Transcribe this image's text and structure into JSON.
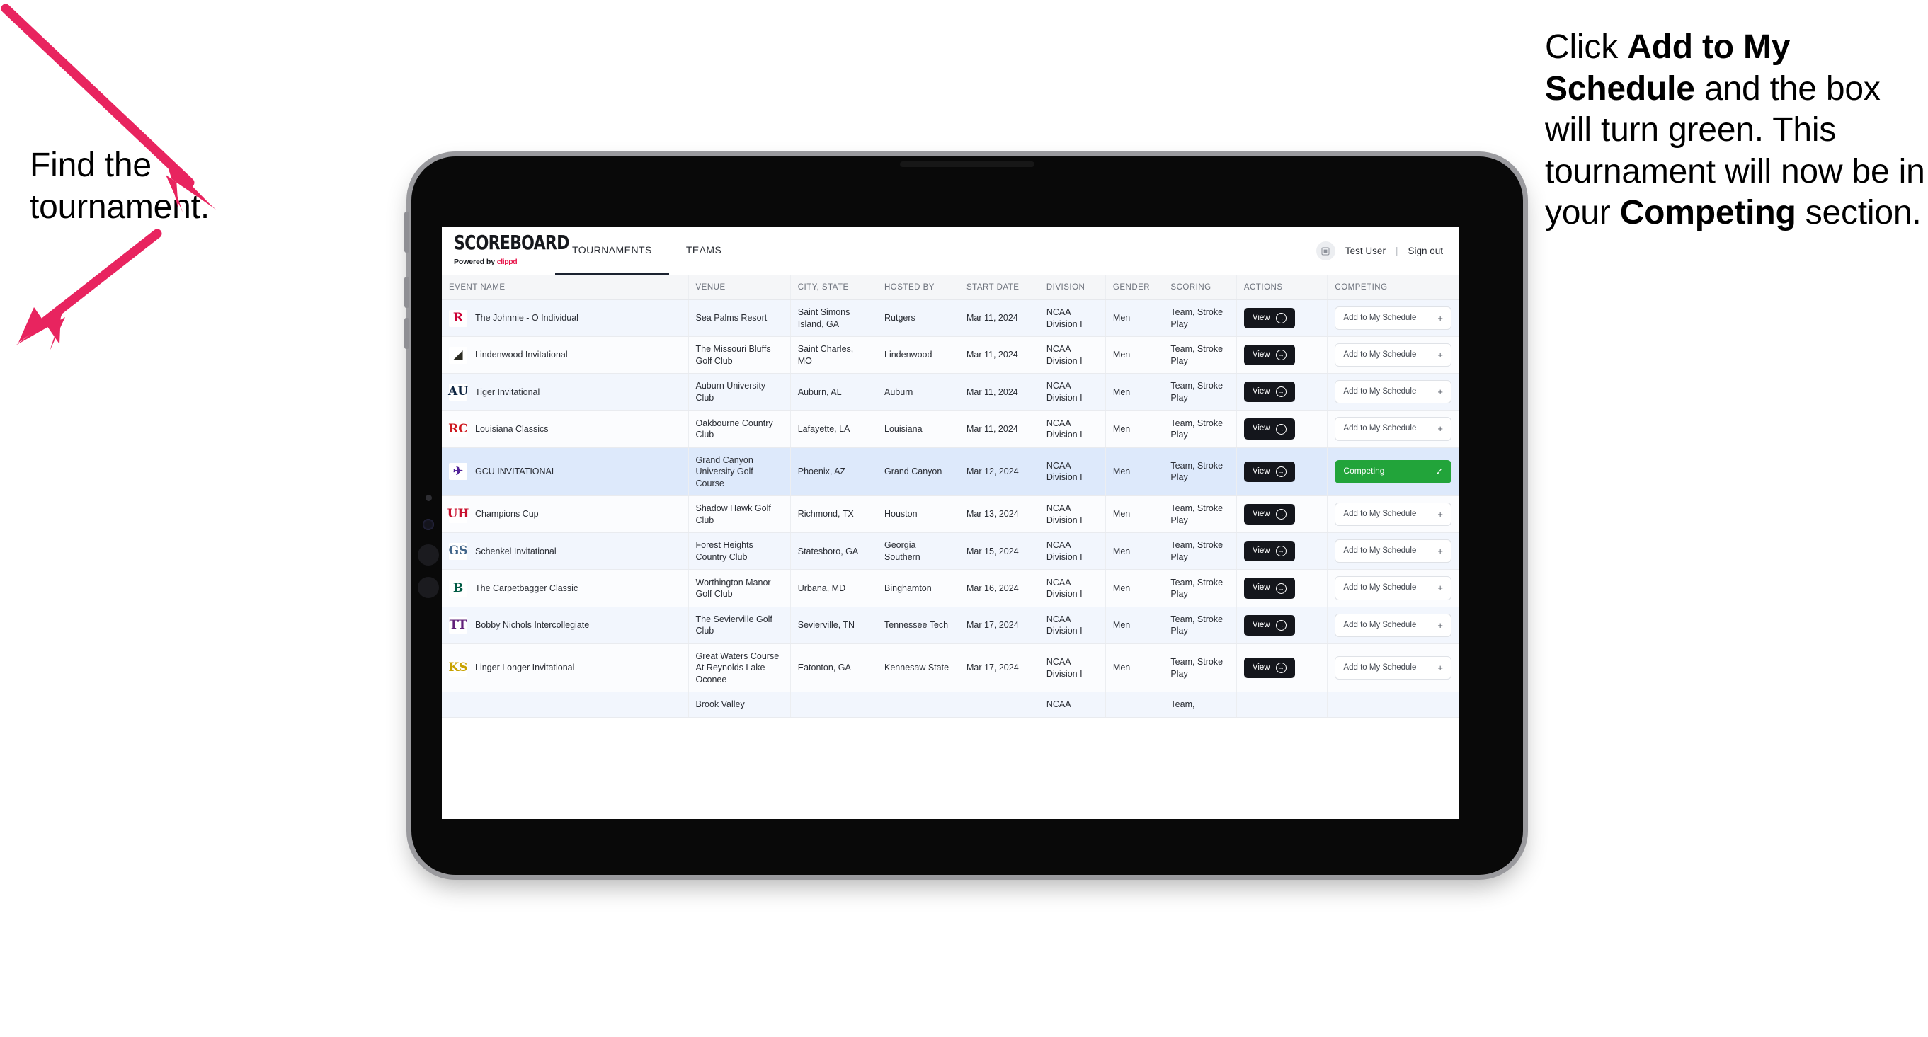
{
  "annotations": {
    "left": {
      "line1": "Find the",
      "line2": "tournament."
    },
    "right": {
      "p1_a": "Click ",
      "p1_b": "Add to My Schedule",
      "p1_c": " and the box will turn green. This tournament will now be in your ",
      "p1_d": "Competing",
      "p1_e": " section."
    },
    "arrow_color": "#e8245f"
  },
  "app": {
    "brand": {
      "title": "SCOREBOARD",
      "powered_prefix": "Powered by ",
      "powered_brand": "clippd",
      "brand_accent": "#e8174c"
    },
    "nav": [
      {
        "label": "TOURNAMENTS",
        "active": true
      },
      {
        "label": "TEAMS",
        "active": false
      }
    ],
    "user": {
      "avatar_icon": "user-avatar-icon",
      "name": "Test User",
      "separator": "|",
      "sign_out": "Sign out"
    }
  },
  "table": {
    "columns": [
      "EVENT NAME",
      "VENUE",
      "CITY, STATE",
      "HOSTED BY",
      "START DATE",
      "DIVISION",
      "GENDER",
      "SCORING",
      "ACTIONS",
      "COMPETING"
    ],
    "buttons": {
      "view": "View",
      "view_icon": "arrow-right-circle-icon",
      "add": "Add to My Schedule",
      "add_icon": "plus-icon",
      "competing": "Competing",
      "competing_icon": "check-icon",
      "competing_color": "#22a43a"
    },
    "rows": [
      {
        "event": "The Johnnie - O Individual",
        "venue": "Sea Palms Resort",
        "city": "Saint Simons Island, GA",
        "host": "Rutgers",
        "date": "Mar 11, 2024",
        "division": "NCAA Division I",
        "gender": "Men",
        "scoring": "Team, Stroke Play",
        "competing": false,
        "logo": {
          "name": "rutgers-logo",
          "text": "R",
          "color": "#cc0033",
          "bg": "#ffffff"
        }
      },
      {
        "event": "Lindenwood Invitational",
        "venue": "The Missouri Bluffs Golf Club",
        "city": "Saint Charles, MO",
        "host": "Lindenwood",
        "date": "Mar 11, 2024",
        "division": "NCAA Division I",
        "gender": "Men",
        "scoring": "Team, Stroke Play",
        "competing": false,
        "logo": {
          "name": "lindenwood-lions-logo",
          "text": "◢",
          "color": "#2b2b22",
          "bg": "#ffffff"
        }
      },
      {
        "event": "Tiger Invitational",
        "venue": "Auburn University Club",
        "city": "Auburn, AL",
        "host": "Auburn",
        "date": "Mar 11, 2024",
        "division": "NCAA Division I",
        "gender": "Men",
        "scoring": "Team, Stroke Play",
        "competing": false,
        "logo": {
          "name": "auburn-logo",
          "text": "AU",
          "color": "#0c2340",
          "bg": "#ffffff"
        }
      },
      {
        "event": "Louisiana Classics",
        "venue": "Oakbourne Country Club",
        "city": "Lafayette, LA",
        "host": "Louisiana",
        "date": "Mar 11, 2024",
        "division": "NCAA Division I",
        "gender": "Men",
        "scoring": "Team, Stroke Play",
        "competing": false,
        "logo": {
          "name": "louisiana-ragin-cajuns-logo",
          "text": "RC",
          "color": "#ce181e",
          "bg": "#ffffff"
        }
      },
      {
        "event": "GCU INVITATIONAL",
        "venue": "Grand Canyon University Golf Course",
        "city": "Phoenix, AZ",
        "host": "Grand Canyon",
        "date": "Mar 12, 2024",
        "division": "NCAA Division I",
        "gender": "Men",
        "scoring": "Team, Stroke Play",
        "competing": true,
        "selected": true,
        "logo": {
          "name": "grand-canyon-lopes-logo",
          "text": "✈",
          "color": "#522398",
          "bg": "#ffffff"
        }
      },
      {
        "event": "Champions Cup",
        "venue": "Shadow Hawk Golf Club",
        "city": "Richmond, TX",
        "host": "Houston",
        "date": "Mar 13, 2024",
        "division": "NCAA Division I",
        "gender": "Men",
        "scoring": "Team, Stroke Play",
        "competing": false,
        "logo": {
          "name": "houston-cougars-logo",
          "text": "UH",
          "color": "#c8102e",
          "bg": "#ffffff"
        }
      },
      {
        "event": "Schenkel Invitational",
        "venue": "Forest Heights Country Club",
        "city": "Statesboro, GA",
        "host": "Georgia Southern",
        "date": "Mar 15, 2024",
        "division": "NCAA Division I",
        "gender": "Men",
        "scoring": "Team, Stroke Play",
        "competing": false,
        "logo": {
          "name": "georgia-southern-eagles-logo",
          "text": "GS",
          "color": "#41658a",
          "bg": "#ffffff"
        }
      },
      {
        "event": "The Carpetbagger Classic",
        "venue": "Worthington Manor Golf Club",
        "city": "Urbana, MD",
        "host": "Binghamton",
        "date": "Mar 16, 2024",
        "division": "NCAA Division I",
        "gender": "Men",
        "scoring": "Team, Stroke Play",
        "competing": false,
        "logo": {
          "name": "binghamton-bearcats-logo",
          "text": "B",
          "color": "#005a43",
          "bg": "#ffffff"
        }
      },
      {
        "event": "Bobby Nichols Intercollegiate",
        "venue": "The Sevierville Golf Club",
        "city": "Sevierville, TN",
        "host": "Tennessee Tech",
        "date": "Mar 17, 2024",
        "division": "NCAA Division I",
        "gender": "Men",
        "scoring": "Team, Stroke Play",
        "competing": false,
        "logo": {
          "name": "tennessee-tech-golden-eagles-logo",
          "text": "TT",
          "color": "#62207a",
          "bg": "#ffffff"
        }
      },
      {
        "event": "Linger Longer Invitational",
        "venue": "Great Waters Course At Reynolds Lake Oconee",
        "city": "Eatonton, GA",
        "host": "Kennesaw State",
        "date": "Mar 17, 2024",
        "division": "NCAA Division I",
        "gender": "Men",
        "scoring": "Team, Stroke Play",
        "competing": false,
        "logo": {
          "name": "kennesaw-state-owls-logo",
          "text": "KS",
          "color": "#c8a200",
          "bg": "#ffffff"
        }
      }
    ],
    "partial_row": {
      "venue": "Brook Valley",
      "division": "NCAA",
      "scoring": "Team,"
    }
  }
}
